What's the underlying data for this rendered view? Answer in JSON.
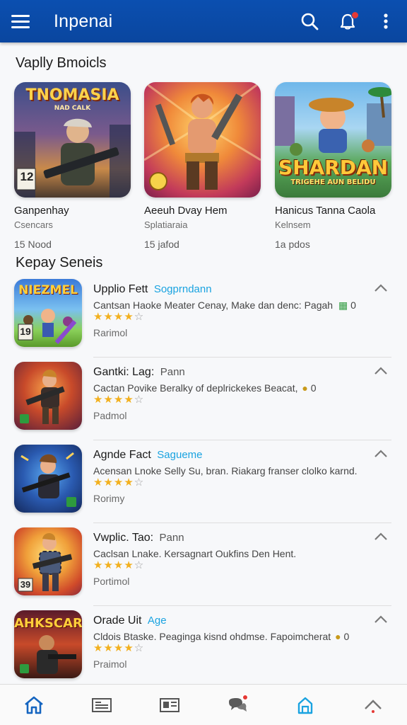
{
  "app": {
    "title": "Inpenai"
  },
  "sections": {
    "featured_title": "Vaplly Bmoicls",
    "list_title": "Kepay Seneis"
  },
  "featured": [
    {
      "art_title": "TNOMASIA",
      "art_sub": "NAD CALK",
      "rating_badge": "12",
      "name": "Ganpenhay",
      "sub": "Csencars",
      "meta": "15 Nood"
    },
    {
      "art_title": "",
      "art_sub": "",
      "rating_badge": "",
      "name": "Aeeuh Dvay Hem",
      "sub": "Splatiaraia",
      "meta": "15 jafod"
    },
    {
      "art_title": "SHARDAN",
      "art_sub": "TRIGEHE AUN BELIDU",
      "rating_badge": "",
      "name": "Hanicus Tanna Caola",
      "sub": "Kelnsem",
      "meta": "1a pdos"
    }
  ],
  "list": [
    {
      "title": "Upplio Fett",
      "tag": "Sogprndann",
      "desc": "Cantsan Haoke Meater Cenay, Make dan denc: Pagah",
      "price": "0",
      "stars_on": 4,
      "status": "Rarimol",
      "thumb_title": "NIEZMEL",
      "thumb_badge": "19"
    },
    {
      "title": "Gantki: Lag:",
      "tag": "Pann",
      "desc": "Cactan Povike Beralky of deplrickekes Beacat,",
      "price": "0",
      "stars_on": 4,
      "status": "Padmol",
      "thumb_title": "",
      "thumb_badge": ""
    },
    {
      "title": "Agnde Fact",
      "tag": "Sagueme",
      "desc": "Acensan Lnoke Selly Su, bran. Riakarg franser clolko karnd.",
      "price": "",
      "stars_on": 4,
      "status": "Rorimy",
      "thumb_title": "",
      "thumb_badge": ""
    },
    {
      "title": "Vwplic. Tao:",
      "tag": "Pann",
      "desc": "Caclsan Lnake. Kersagnart Oukfins Den Hent.",
      "price": "",
      "stars_on": 4,
      "status": "Portimol",
      "thumb_title": "",
      "thumb_badge": "39"
    },
    {
      "title": "Orade Uit",
      "tag": "Age",
      "desc": "Cldois Btaske. Peaginga kisnd ohdmse. Fapoimcherat",
      "price": "0",
      "stars_on": 4,
      "status": "Praimol",
      "thumb_title": "AHKSCAR",
      "thumb_badge": ""
    }
  ],
  "colors": {
    "appbar": "#0b4fb0",
    "accent_tag": "#1aa3e0",
    "star": "#f2b01e",
    "badge": "#e53935"
  },
  "icons": {
    "appbar": [
      "menu-icon",
      "search-icon",
      "notification-icon",
      "more-vertical-icon"
    ],
    "bottomnav": [
      "home-icon",
      "library-icon",
      "id-card-icon",
      "chat-icon",
      "store-icon",
      "up-icon"
    ]
  }
}
